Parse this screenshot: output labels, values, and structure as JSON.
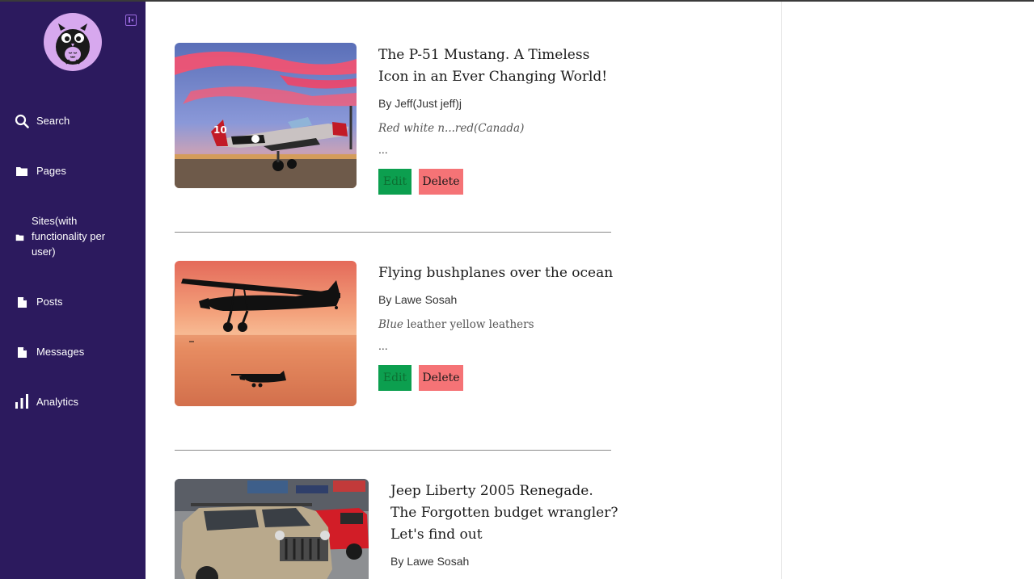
{
  "sidebar": {
    "items": [
      {
        "label": "Search",
        "icon": "search-icon"
      },
      {
        "label": "Pages",
        "icon": "folder-icon"
      },
      {
        "label": "Sites(with functionality per user)",
        "icon": "folder-icon"
      },
      {
        "label": "Posts",
        "icon": "document-icon"
      },
      {
        "label": "Messages",
        "icon": "document-icon"
      },
      {
        "label": "Analytics",
        "icon": "bar-chart-icon"
      }
    ]
  },
  "posts": [
    {
      "title": "The P-51 Mustang. A Timeless Icon in an Ever Changing World!",
      "author": "By Jeff(Just jeff)j",
      "excerpt_italic": "Red white n...red(Canada)",
      "excerpt_rest": "",
      "more": "...",
      "edit_label": "Edit",
      "delete_label": "Delete"
    },
    {
      "title": "Flying bushplanes over the ocean",
      "author": "By Lawe Sosah",
      "excerpt_italic": "Blue",
      "excerpt_rest": " leather yellow leathers",
      "more": "...",
      "edit_label": "Edit",
      "delete_label": "Delete"
    },
    {
      "title": "Jeep Liberty 2005 Renegade. The Forgotten budget wrangler? Let's find out",
      "author": "By Lawe Sosah"
    }
  ],
  "colors": {
    "sidebar_bg": "#2c1a5e",
    "edit_button": "#0c9f4f",
    "delete_button": "#f57376"
  }
}
